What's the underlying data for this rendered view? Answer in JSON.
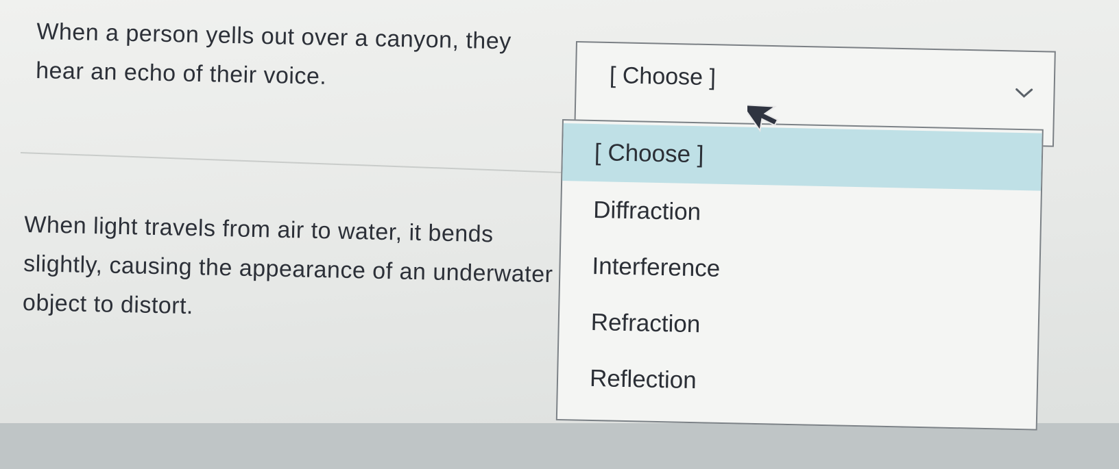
{
  "questions": [
    {
      "text": "When a person yells out over a canyon, they hear an echo of their voice."
    },
    {
      "text": "When light travels from air to water, it bends slightly, causing the appearance of an underwater object to distort."
    }
  ],
  "select": {
    "value": "[ Choose ]",
    "icon": "chevron-down-icon"
  },
  "dropdown": {
    "options": [
      "[ Choose ]",
      "Diffraction",
      "Interference",
      "Refraction",
      "Reflection"
    ],
    "highlighted_index": 0
  },
  "colors": {
    "highlight": "#bfe0e6",
    "text": "#2b2f36",
    "border": "#7a7f84"
  }
}
